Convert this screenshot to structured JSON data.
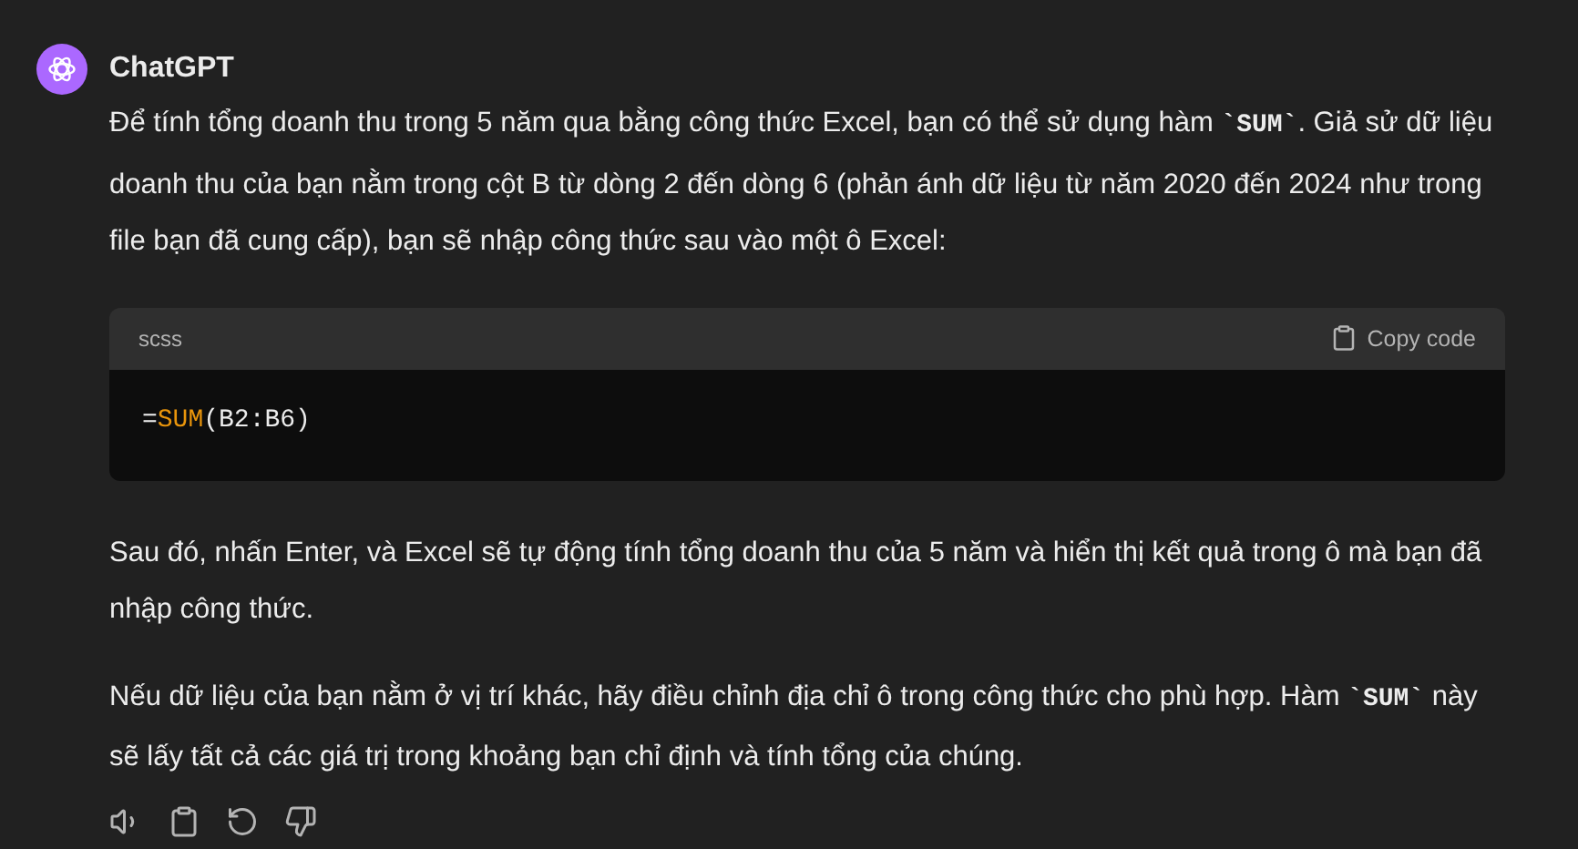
{
  "message": {
    "author": "ChatGPT",
    "paragraphs_before": [
      "Để tính tổng doanh thu trong 5 năm qua bằng công thức Excel, bạn có thể sử dụng hàm **`SUM`**. Giả sử dữ liệu doanh thu của bạn nằm trong cột B từ dòng 2 đến dòng 6 (phản ánh dữ liệu từ năm 2020 đến 2024 như trong file bạn đã cung cấp), bạn sẽ nhập công thức sau vào một ô Excel:"
    ],
    "code_block": {
      "language": "scss",
      "copy_label": "Copy code",
      "tokens": [
        {
          "text": "=",
          "kind": "plain"
        },
        {
          "text": "SUM",
          "kind": "function"
        },
        {
          "text": "(B2:B6)",
          "kind": "plain"
        }
      ]
    },
    "paragraphs_after": [
      "Sau đó, nhấn Enter, và Excel sẽ tự động tính tổng doanh thu của 5 năm và hiển thị kết quả trong ô mà bạn đã nhập công thức.",
      "Nếu dữ liệu của bạn nằm ở vị trí khác, hãy điều chỉnh địa chỉ ô trong công thức cho phù hợp. Hàm **`SUM`** này sẽ lấy tất cả các giá trị trong khoảng bạn chỉ định và tính tổng của chúng."
    ]
  }
}
